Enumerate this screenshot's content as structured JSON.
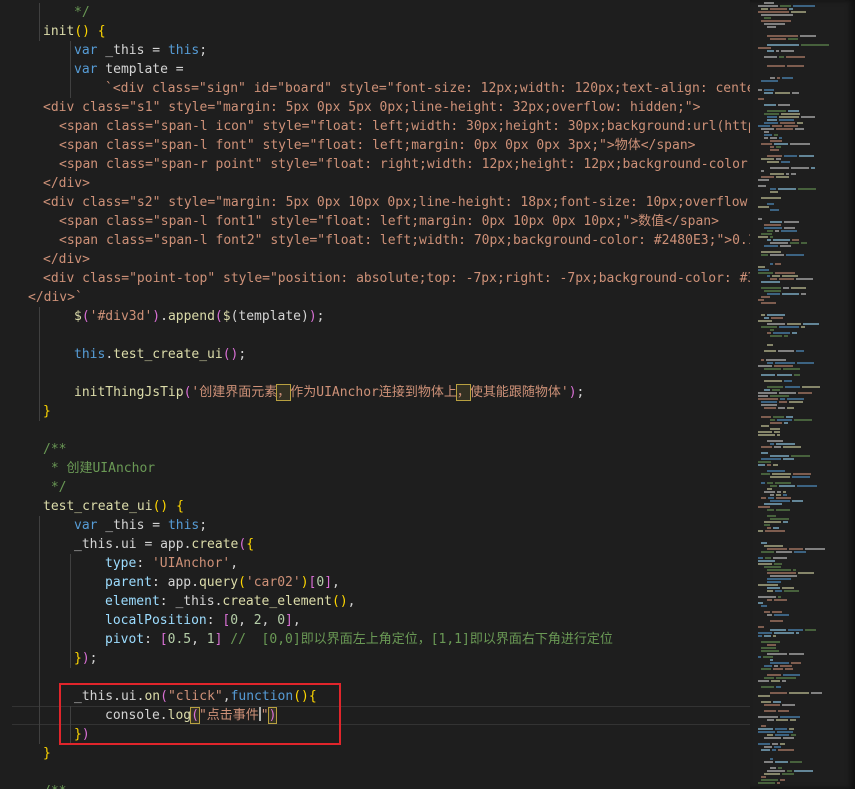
{
  "editor": {
    "lines": [
      {
        "indent": 1,
        "tokens": [
          [
            "cmt",
            "*/"
          ]
        ]
      },
      {
        "indent": 0,
        "tokens": [
          [
            "fn",
            "init"
          ],
          [
            "brk",
            "()"
          ],
          [
            "punc",
            " "
          ],
          [
            "brk",
            "{"
          ]
        ]
      },
      {
        "indent": 1,
        "tokens": [
          [
            "kw",
            "var"
          ],
          [
            "punc",
            " _this = "
          ],
          [
            "kw",
            "this"
          ],
          [
            "punc",
            ";"
          ]
        ]
      },
      {
        "indent": 1,
        "tokens": [
          [
            "kw",
            "var"
          ],
          [
            "punc",
            " template ="
          ]
        ]
      },
      {
        "indent": 2,
        "tokens": [
          [
            "str",
            "`<div class=\"sign\" id=\"board\" style=\"font-size: 12px;width: 120px;text-align: center"
          ]
        ]
      },
      {
        "indent": -1,
        "tokens": [
          [
            "str",
            "<div class=\"s1\" style=\"margin: 5px 0px 5px 0px;line-height: 32px;overflow: hidden;\">"
          ]
        ]
      },
      {
        "indent": -1,
        "pad": 2,
        "tokens": [
          [
            "str",
            "<span class=\"span-l icon\" style=\"float: left;width: 30px;height: 30px;background:url(http"
          ]
        ]
      },
      {
        "indent": -1,
        "pad": 2,
        "tokens": [
          [
            "str",
            "<span class=\"span-l font\" style=\"float: left;margin: 0px 0px 0px 3px;\">物体</span>"
          ]
        ]
      },
      {
        "indent": -1,
        "pad": 2,
        "tokens": [
          [
            "str",
            "<span class=\"span-r point\" style=\"float: right;width: 12px;height: 12px;background-color:"
          ]
        ]
      },
      {
        "indent": -1,
        "tokens": [
          [
            "str",
            "</div>"
          ]
        ]
      },
      {
        "indent": -1,
        "tokens": [
          [
            "str",
            "<div class=\"s2\" style=\"margin: 5px 0px 10px 0px;line-height: 18px;font-size: 10px;overflow:"
          ]
        ]
      },
      {
        "indent": -1,
        "pad": 2,
        "tokens": [
          [
            "str",
            "<span class=\"span-l font1\" style=\"float: left;margin: 0px 10px 0px 10px;\">数值</span>"
          ]
        ]
      },
      {
        "indent": -1,
        "pad": 2,
        "tokens": [
          [
            "str",
            "<span class=\"span-l font2\" style=\"float: left;width: 70px;background-color: #2480E3;\">0.1"
          ]
        ]
      },
      {
        "indent": -1,
        "tokens": [
          [
            "str",
            "</div>"
          ]
        ]
      },
      {
        "indent": -1,
        "tokens": [
          [
            "str",
            "<div class=\"point-top\" style=\"position: absolute;top: -7px;right: -7px;background-color: #3"
          ]
        ]
      },
      {
        "indent": -2,
        "tokens": [
          [
            "str",
            "</div>`"
          ]
        ]
      },
      {
        "indent": 1,
        "tokens": [
          [
            "fn",
            "$"
          ],
          [
            "brk2",
            "("
          ],
          [
            "str",
            "'#div3d'"
          ],
          [
            "brk2",
            ")"
          ],
          [
            "punc",
            "."
          ],
          [
            "fn",
            "append"
          ],
          [
            "brk2",
            "("
          ],
          [
            "fn",
            "$"
          ],
          [
            "punc",
            "(template)"
          ],
          [
            "brk2",
            ")"
          ],
          [
            "punc",
            ";"
          ]
        ]
      },
      {
        "indent": 1,
        "tokens": []
      },
      {
        "indent": 1,
        "tokens": [
          [
            "kw",
            "this"
          ],
          [
            "punc",
            "."
          ],
          [
            "fn",
            "test_create_ui"
          ],
          [
            "brk2",
            "()"
          ],
          [
            "punc",
            ";"
          ]
        ]
      },
      {
        "indent": 1,
        "tokens": []
      },
      {
        "indent": 1,
        "tokens": [
          [
            "fn",
            "initThingJsTip"
          ],
          [
            "brk2",
            "("
          ],
          [
            "str",
            "'创建界面元素"
          ],
          [
            "hl",
            "，"
          ],
          [
            "str",
            "作为UIAnchor连接到物体上"
          ],
          [
            "hl",
            "，"
          ],
          [
            "str",
            "使其能跟随物体'"
          ],
          [
            "brk2",
            ")"
          ],
          [
            "punc",
            ";"
          ]
        ]
      },
      {
        "indent": 0,
        "tokens": [
          [
            "brk",
            "}"
          ]
        ]
      },
      {
        "indent": 0,
        "tokens": []
      },
      {
        "indent": 0,
        "tokens": [
          [
            "cmt",
            "/**"
          ]
        ]
      },
      {
        "indent": 0,
        "tokens": [
          [
            "cmt",
            " * 创建UIAnchor"
          ]
        ]
      },
      {
        "indent": 0,
        "tokens": [
          [
            "cmt",
            " */"
          ]
        ]
      },
      {
        "indent": 0,
        "tokens": [
          [
            "fn",
            "test_create_ui"
          ],
          [
            "brk",
            "()"
          ],
          [
            "punc",
            " "
          ],
          [
            "brk",
            "{"
          ]
        ]
      },
      {
        "indent": 1,
        "tokens": [
          [
            "kw",
            "var"
          ],
          [
            "punc",
            " _this = "
          ],
          [
            "kw",
            "this"
          ],
          [
            "punc",
            ";"
          ]
        ]
      },
      {
        "indent": 1,
        "tokens": [
          [
            "punc",
            "_this.ui = app."
          ],
          [
            "fn",
            "create"
          ],
          [
            "brk2",
            "("
          ],
          [
            "brk",
            "{"
          ]
        ]
      },
      {
        "indent": 2,
        "tokens": [
          [
            "var",
            "type"
          ],
          [
            "punc",
            ": "
          ],
          [
            "str",
            "'UIAnchor'"
          ],
          [
            "punc",
            ","
          ]
        ]
      },
      {
        "indent": 2,
        "tokens": [
          [
            "var",
            "parent"
          ],
          [
            "punc",
            ": app."
          ],
          [
            "fn",
            "query"
          ],
          [
            "brk",
            "("
          ],
          [
            "str",
            "'car02'"
          ],
          [
            "brk",
            ")"
          ],
          [
            "brk2",
            "["
          ],
          [
            "num",
            "0"
          ],
          [
            "brk2",
            "]"
          ],
          [
            "punc",
            ","
          ]
        ]
      },
      {
        "indent": 2,
        "tokens": [
          [
            "var",
            "element"
          ],
          [
            "punc",
            ": _this."
          ],
          [
            "fn",
            "create_element"
          ],
          [
            "brk",
            "()"
          ],
          [
            "punc",
            ","
          ]
        ]
      },
      {
        "indent": 2,
        "tokens": [
          [
            "var",
            "localPosition"
          ],
          [
            "punc",
            ": "
          ],
          [
            "brk2",
            "["
          ],
          [
            "num",
            "0"
          ],
          [
            "punc",
            ", "
          ],
          [
            "num",
            "2"
          ],
          [
            "punc",
            ", "
          ],
          [
            "num",
            "0"
          ],
          [
            "brk2",
            "]"
          ],
          [
            "punc",
            ","
          ]
        ]
      },
      {
        "indent": 2,
        "tokens": [
          [
            "var",
            "pivot"
          ],
          [
            "punc",
            ": "
          ],
          [
            "brk2",
            "["
          ],
          [
            "num",
            "0.5"
          ],
          [
            "punc",
            ", "
          ],
          [
            "num",
            "1"
          ],
          [
            "brk2",
            "]"
          ],
          [
            "cmt",
            " //  [0,0]即以界面左上角定位，[1,1]即以界面右下角进行定位"
          ]
        ]
      },
      {
        "indent": 1,
        "tokens": [
          [
            "brk",
            "}"
          ],
          [
            "brk2",
            ")"
          ],
          [
            "punc",
            ";"
          ]
        ]
      },
      {
        "indent": 1,
        "tokens": []
      },
      {
        "indent": 1,
        "tokens": [
          [
            "punc",
            "_this.ui."
          ],
          [
            "fn",
            "on"
          ],
          [
            "brk2",
            "("
          ],
          [
            "str",
            "\"click\""
          ],
          [
            "punc",
            ","
          ],
          [
            "kw",
            "function"
          ],
          [
            "brk",
            "()"
          ],
          [
            "brk",
            "{"
          ]
        ]
      },
      {
        "indent": 2,
        "current": true,
        "tokens": [
          [
            "punc",
            "console."
          ],
          [
            "fn",
            "log"
          ],
          [
            "hlbrk",
            "("
          ],
          [
            "str",
            "\"点击事件"
          ],
          [
            "caret",
            ""
          ],
          [
            "str",
            "\""
          ],
          [
            "hlbrk",
            ")"
          ]
        ]
      },
      {
        "indent": 1,
        "tokens": [
          [
            "brk",
            "}"
          ],
          [
            "brk2",
            ")"
          ]
        ]
      },
      {
        "indent": 0,
        "tokens": [
          [
            "brk",
            "}"
          ]
        ]
      },
      {
        "indent": 0,
        "tokens": []
      },
      {
        "indent": 0,
        "tokens": [
          [
            "cmt",
            "/**"
          ]
        ]
      }
    ]
  },
  "highlight": {
    "color": "#e0252b",
    "label": "click-event-handler"
  },
  "colors": {
    "background": "#1e1e1e",
    "keyword": "#569cd6",
    "string": "#ce9178",
    "function": "#dcdcaa",
    "variable": "#9cdcfe",
    "number": "#b5cea8",
    "comment": "#6a9955"
  }
}
